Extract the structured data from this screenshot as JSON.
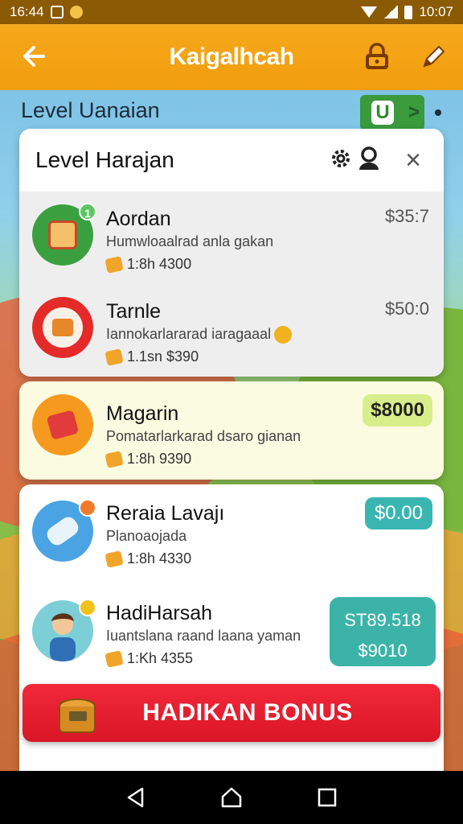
{
  "status_bar": {
    "time_left": "16:44",
    "time_right": "10:07"
  },
  "app_bar": {
    "title": "Kaigalhcah"
  },
  "background": {
    "title": "Level Uanaian",
    "badge": "U",
    "badge_chevron": ">"
  },
  "dialog": {
    "title": "Level Harajan",
    "close": "×",
    "items": [
      {
        "name": "Aordan",
        "desc": "Humwloaalrad anla gakan",
        "meta": "1:8h 4300",
        "price": "$35:7",
        "badge": "1"
      },
      {
        "name": "Tarnle",
        "desc": "Iannokarlararad iaragaaal",
        "meta": "1.1sn $390",
        "price": "$50:0"
      }
    ]
  },
  "card2": {
    "name": "Magarin",
    "desc": "Pomatarlarkarad dsaro gianan",
    "meta": "1:8h 9390",
    "price": "$8000"
  },
  "card3": {
    "items": [
      {
        "name": "Reraia Lavajı",
        "desc": "Planoaojada",
        "meta": "1:8h 4330",
        "price": "$0.00"
      },
      {
        "name": "HadiHarsah",
        "desc": "Iuantslana raand laana yaman",
        "meta": "1:Kh 4355",
        "price_top": "ST89.518",
        "price_bottom": "$9010"
      }
    ]
  },
  "bonus_button": {
    "label": "HADIKAN BONUS"
  },
  "colors": {
    "app_bar": "#f6a91c",
    "bonus": "#e81f30",
    "teal": "#3ab6b2",
    "green": "#3a9a3c"
  }
}
